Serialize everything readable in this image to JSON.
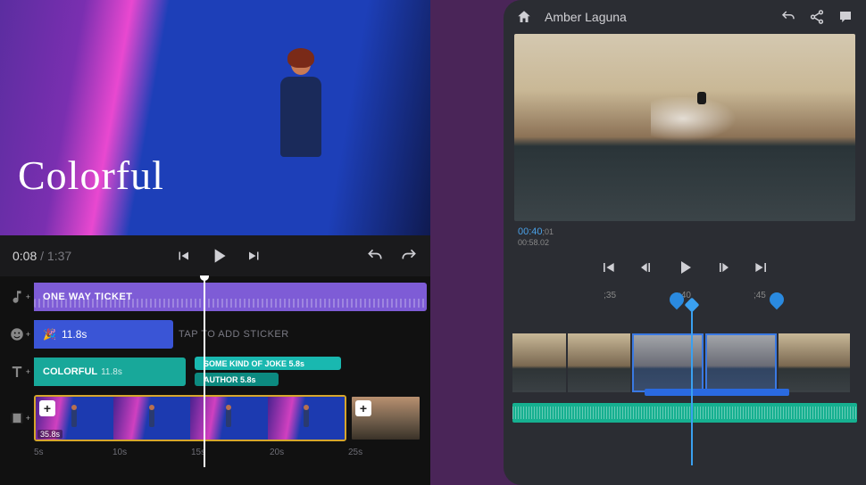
{
  "left": {
    "brand": "Colorful",
    "time": {
      "current": "0:08",
      "sep": " / ",
      "duration": "1:37"
    },
    "tracks": {
      "music": {
        "title": "ONE WAY TICKET"
      },
      "sticker": {
        "duration": "11.8s",
        "add_hint": "TAP TO ADD STICKER"
      },
      "text": {
        "main": {
          "label": "COLORFUL",
          "duration": "11.8s"
        },
        "sub1": {
          "label": "SOME KIND OF JOKE",
          "duration": "5.8s"
        },
        "sub2": {
          "label": "AUTHOR",
          "duration": "5.8s"
        }
      },
      "video": {
        "clip1_duration": "35.8s"
      }
    },
    "ruler": [
      "5s",
      "10s",
      "15s",
      "20s",
      "25s"
    ]
  },
  "right": {
    "project": "Amber Laguna",
    "timecode": {
      "main": "00:40",
      "frames": ";01",
      "sub": "00:58.02"
    },
    "ruler": [
      ";35",
      ";40",
      ";45"
    ]
  }
}
